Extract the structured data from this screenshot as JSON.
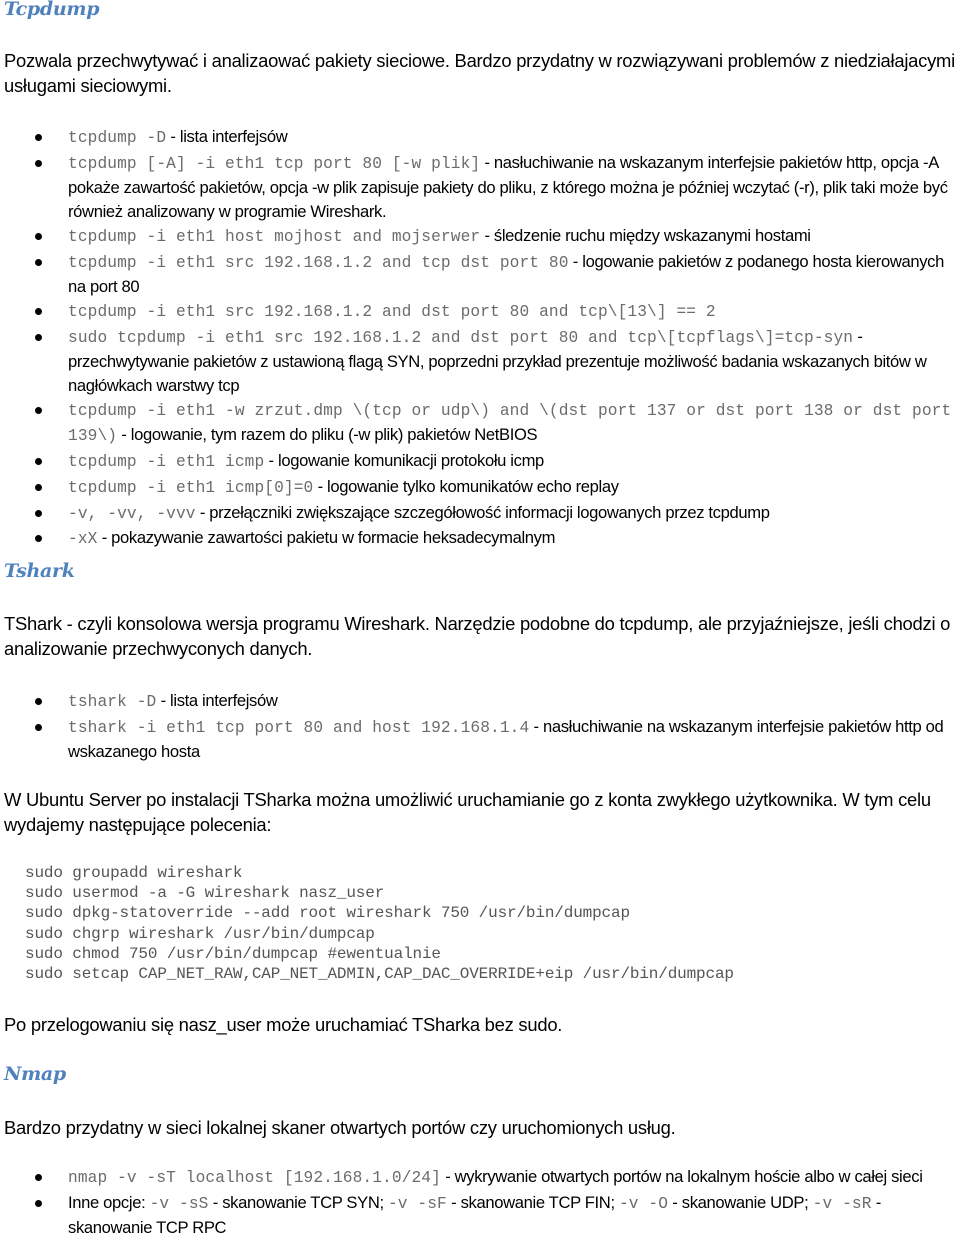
{
  "sections": {
    "tcpdump": {
      "heading": "Tcpdump",
      "intro": "Pozwala przechwytywać i analizaować pakiety sieciowe. Bardzo przydatny w rozwiązywani problemów z niedziałajacymi usługami sieciowymi.",
      "items": [
        {
          "code": "tcpdump -D",
          "text": " - lista interfejsów"
        },
        {
          "code": "tcpdump [-A] -i eth1 tcp port 80 [-w plik]",
          "text": " - nasłuchiwanie na wskazanym interfejsie pakietów http, opcja -A pokaże zawartość pakietów, opcja -w plik zapisuje pakiety do pliku, z którego można je później wczytać (-r), plik taki może być również analizowany w programie Wireshark."
        },
        {
          "code": "tcpdump -i eth1 host mojhost and mojserwer",
          "text": " - śledzenie ruchu między wskazanymi hostami"
        },
        {
          "code": "tcpdump -i eth1 src 192.168.1.2 and tcp dst port 80",
          "text": " - logowanie pakietów z podanego hosta kierowanych na port 80"
        },
        {
          "code": "tcpdump -i eth1 src 192.168.1.2 and dst port 80 and tcp\\[13\\] == 2",
          "text": ""
        },
        {
          "code": "sudo tcpdump -i eth1 src 192.168.1.2 and dst port 80 and tcp\\[tcpflags\\]=tcp-syn",
          "text": " - przechwytywanie pakietów z ustawioną flagą SYN, poprzedni przykład prezentuje możliwość badania wskazanych bitów w nagłówkach warstwy tcp"
        },
        {
          "code": "tcpdump -i eth1 -w zrzut.dmp \\(tcp or udp\\) and \\(dst port 137 or dst port 138 or dst port 139\\)",
          "text": " - logowanie, tym razem do pliku (-w plik) pakietów NetBIOS"
        },
        {
          "code": "tcpdump -i eth1 icmp",
          "text": " - logowanie komunikacji protokołu icmp"
        },
        {
          "code": "tcpdump -i eth1 icmp[0]=0",
          "text": " - logowanie tylko komunikatów echo replay"
        },
        {
          "code": "-v, -vv, -vvv",
          "text": " - przełączniki zwiększające szczegółowość informacji logowanych przez tcpdump"
        },
        {
          "code": "-xX",
          "text": " - pokazywanie zawartości pakietu w formacie heksadecymalnym"
        }
      ]
    },
    "tshark": {
      "heading": "Tshark",
      "intro": "TShark - czyli konsolowa wersja programu Wireshark. Narzędzie podobne do tcpdump, ale przyjaźniejsze, jeśli chodzi o analizowanie przechwyconych danych.",
      "items": [
        {
          "code": "tshark -D",
          "text": " - lista interfejsów"
        },
        {
          "code": "tshark -i eth1 tcp port 80 and host 192.168.1.4",
          "text": " - nasłuchiwanie na wskazanym interfejsie pakietów http od wskazanego hosta"
        }
      ],
      "ubuntu_note": "W Ubuntu Server po instalacji TSharka można umożliwić uruchamianie go z konta zwykłego użytkownika. W tym celu wydajemy następujące polecenia:",
      "commands": [
        "sudo groupadd wireshark",
        "sudo usermod -a -G wireshark nasz_user",
        "sudo dpkg-statoverride --add root wireshark 750 /usr/bin/dumpcap",
        "sudo chgrp wireshark /usr/bin/dumpcap",
        "sudo chmod 750 /usr/bin/dumpcap #ewentualnie",
        "sudo setcap CAP_NET_RAW,CAP_NET_ADMIN,CAP_DAC_OVERRIDE+eip /usr/bin/dumpcap"
      ],
      "after_note": "Po przelogowaniu się nasz_user może uruchamiać TSharka bez sudo."
    },
    "nmap": {
      "heading": "Nmap",
      "intro": "Bardzo przydatny w sieci lokalnej skaner otwartych portów czy uruchomionych usług.",
      "items": [
        {
          "code": "nmap -v -sT localhost [192.168.1.0/24]",
          "text": " - wykrywanie otwartych portów na lokalnym hoście albo w całej sieci"
        }
      ],
      "other_options": {
        "prefix": "Inne opcje: ",
        "parts": [
          {
            "code": "-v -sS",
            "text": " - skanowanie TCP SYN; "
          },
          {
            "code": "-v -sF",
            "text": " - skanowanie TCP FIN; "
          },
          {
            "code": "-v -O",
            "text": " - skanowanie UDP; "
          },
          {
            "code": "-v -sR",
            "text": " - skanowanie TCP RPC"
          }
        ]
      }
    }
  }
}
